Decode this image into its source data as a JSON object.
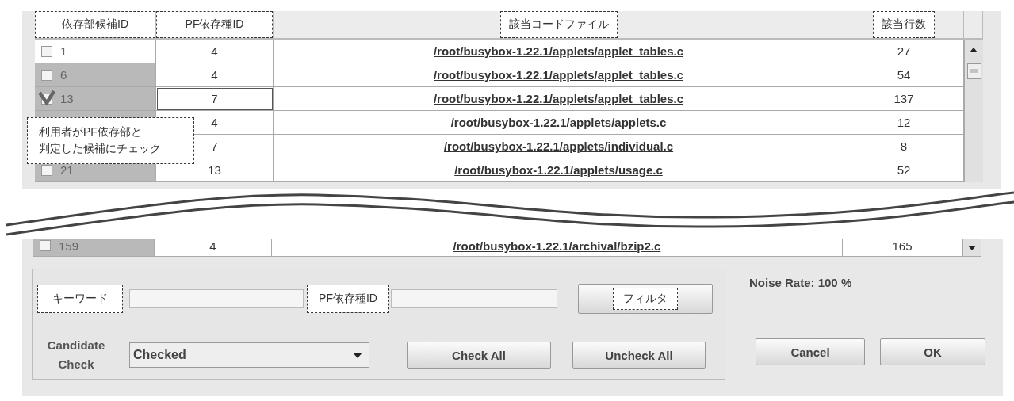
{
  "table": {
    "columns": [
      {
        "label": "依存部候補ID"
      },
      {
        "label": "PF依存種ID"
      },
      {
        "label": "該当コードファイル"
      },
      {
        "label": "該当行数"
      }
    ],
    "rows": [
      {
        "id": "1",
        "checked": false,
        "shaded": false,
        "pf_id": "4",
        "pf_focused": false,
        "file": "/root/busybox-1.22.1/applets/applet_tables.c",
        "lines": "27"
      },
      {
        "id": "6",
        "checked": false,
        "shaded": true,
        "pf_id": "4",
        "pf_focused": false,
        "file": "/root/busybox-1.22.1/applets/applet_tables.c",
        "lines": "54"
      },
      {
        "id": "13",
        "checked": true,
        "shaded": true,
        "pf_id": "7",
        "pf_focused": true,
        "file": "/root/busybox-1.22.1/applets/applet_tables.c",
        "lines": "137"
      },
      {
        "shaded": true,
        "pf_id": "4",
        "pf_focused": false,
        "file": "/root/busybox-1.22.1/applets/applets.c",
        "lines": "12"
      },
      {
        "pf_id": "7",
        "pf_focused": false,
        "file": "/root/busybox-1.22.1/applets/individual.c",
        "lines": "8"
      },
      {
        "id": "21",
        "checked": false,
        "shaded": true,
        "pf_id": "13",
        "pf_focused": false,
        "file": "/root/busybox-1.22.1/applets/usage.c",
        "lines": "52"
      }
    ],
    "callout_lines": [
      "利用者がPF依存部と",
      "判定した候補にチェック"
    ],
    "lower_rows": [
      {
        "id": "159",
        "checked": false,
        "shaded": true,
        "pf_id": "4",
        "pf_focused": false,
        "file": "/root/busybox-1.22.1/archival/bzip2.c",
        "lines": "165"
      }
    ]
  },
  "filter": {
    "keyword_label": "キーワード",
    "pf_label": "PF依存種ID",
    "filter_button": "フィルタ",
    "candidate_label": "Candidate Check",
    "dropdown": {
      "value": "Checked"
    },
    "buttons": [
      "Check All",
      "Uncheck All"
    ]
  },
  "noise_rate": "Noise Rate: 100 %",
  "dialog_buttons": [
    "Cancel",
    "OK"
  ]
}
